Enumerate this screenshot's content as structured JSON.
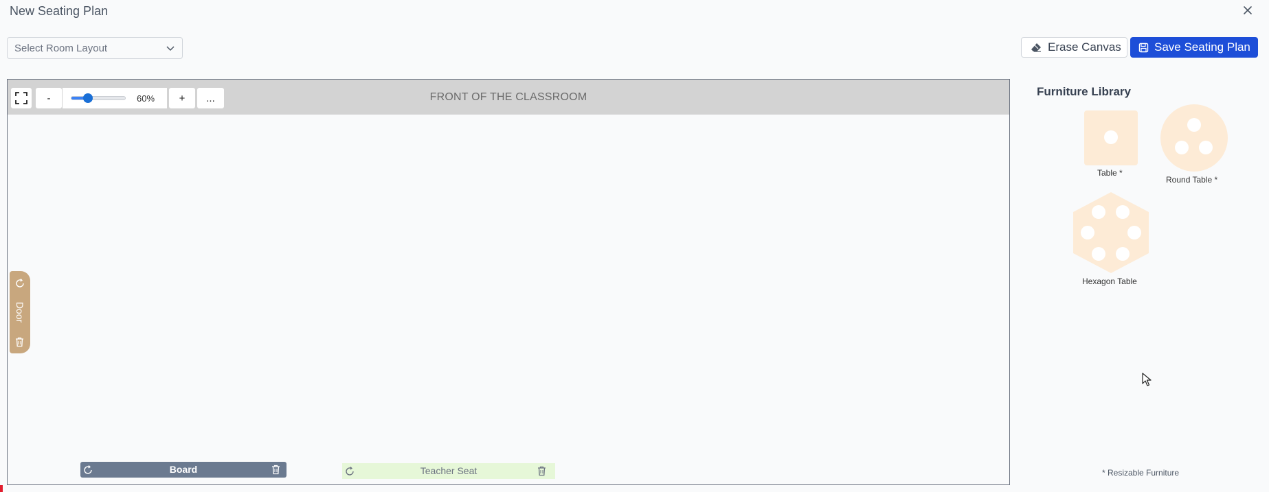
{
  "window": {
    "title": "New Seating Plan"
  },
  "toolbar": {
    "room_select_placeholder": "Select Room Layout",
    "erase_label": "Erase Canvas",
    "save_label": "Save Seating Plan"
  },
  "canvas": {
    "front_label": "FRONT OF THE CLASSROOM",
    "zoom_minus": "-",
    "zoom_plus": "+",
    "more": "...",
    "zoom_value": "60%",
    "zoom_percent": 60
  },
  "objects": {
    "door_label": "Door",
    "board_label": "Board",
    "teacher_seat_label": "Teacher Seat"
  },
  "library": {
    "title": "Furniture Library",
    "items": [
      {
        "label": "Table *"
      },
      {
        "label": "Round Table *"
      },
      {
        "label": "Hexagon Table"
      }
    ],
    "note": "* Resizable Furniture"
  },
  "colors": {
    "primary": "#1d4ed8",
    "furniture_fill": "#fdebd6",
    "door": "#c8a77e",
    "board": "#6b7a90",
    "teacher_seat": "#e6f7d8"
  }
}
